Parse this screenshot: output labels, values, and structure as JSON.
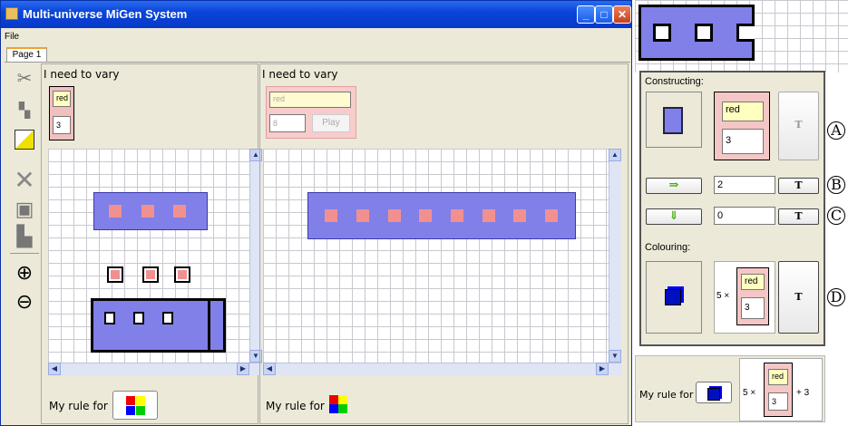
{
  "window": {
    "title": "Multi-universe MiGen System",
    "menu_file": "File",
    "tab_page1": "Page 1",
    "min": "_",
    "max": "□",
    "close": "✕"
  },
  "left_universe": {
    "vary_label": "I need to vary",
    "var_name": "red",
    "var_value": "3",
    "rule_label": "My rule for"
  },
  "right_universe": {
    "vary_label": "I need to vary",
    "var_name": "red",
    "var_value": "8",
    "play_label": "Play",
    "rule_label": "My rule for"
  },
  "side": {
    "constructing_label": "Constructing:",
    "colouring_label": "Colouring:",
    "var_name": "red",
    "var_value": "3",
    "t_label": "T",
    "right_arrow": "⇒",
    "right_value": "2",
    "down_arrow": "⇓",
    "down_value": "0",
    "times_label": "5 ×",
    "col_var_name": "red",
    "col_var_value": "3",
    "markers": [
      "A",
      "B",
      "C",
      "D"
    ]
  },
  "bottom_rule": {
    "label": "My rule for",
    "times": "5 ×",
    "var_name": "red",
    "var_value": "3",
    "plus": "+ 3"
  },
  "colors": {
    "block": "#8080e8",
    "red_tile": "#f29090",
    "titlebar": "#0a45d8"
  }
}
